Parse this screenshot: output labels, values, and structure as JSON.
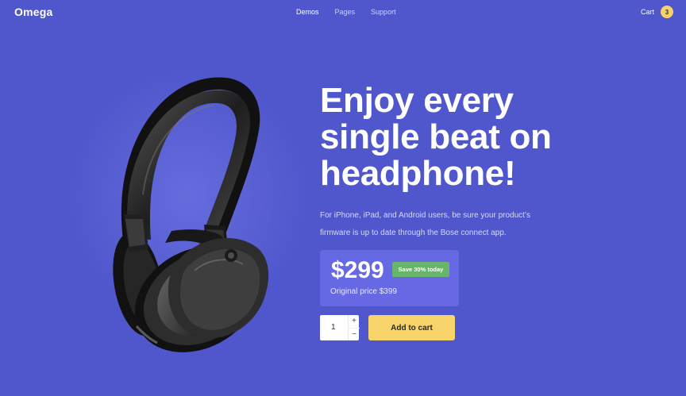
{
  "header": {
    "logo": "Omega",
    "nav": [
      "Demos",
      "Pages",
      "Support"
    ],
    "cart": {
      "label": "Cart",
      "count": "3"
    }
  },
  "product": {
    "image_icon": "headphone-product-image",
    "headline_lines": [
      "Enjoy every",
      "single beat on",
      "headphone!"
    ],
    "description_lines": [
      "For iPhone, iPad, and Android users, be sure your product’s",
      "firmware is up to date through the Bose connect app."
    ],
    "price": "$299",
    "save_badge": "Save 30% today",
    "original_price": "Original price $399",
    "quantity": "1",
    "qty_plus": "+",
    "qty_minus": "−",
    "add_to_cart": "Add to cart"
  },
  "colors": {
    "background": "#5057cc",
    "price_card": "#6769e4",
    "save_badge": "#67b46a",
    "cta": "#f6d469",
    "cart_badge": "#f5d36a"
  }
}
